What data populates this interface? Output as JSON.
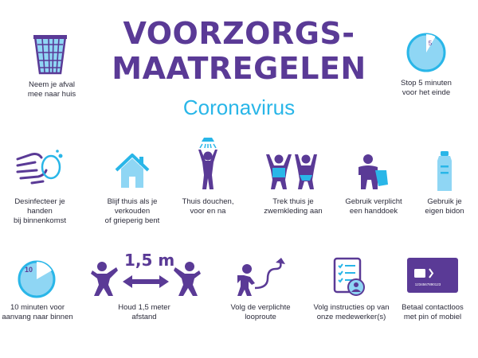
{
  "header": {
    "title_line1": "VOORZORGS-",
    "title_line2": "MAATREGELEN",
    "subtitle": "Coronavirus"
  },
  "colors": {
    "purple": "#5a3a96",
    "blue": "#29b6e8",
    "lightblue": "#8fd6f4"
  },
  "items": [
    {
      "icon": "trash-basket-icon",
      "line1": "Neem je afval",
      "line2": "mee naar huis"
    },
    {
      "icon": "clock-5-icon",
      "clock_label": "5",
      "line1": "Stop 5 minuten",
      "line2": "voor het einde"
    },
    {
      "icon": "washing-hands-icon",
      "line1": "Desinfecteer je handen",
      "line2": "bij binnenkomst"
    },
    {
      "icon": "house-icon",
      "line1": "Blijf thuis als je verkouden",
      "line2": "of grieperig bent"
    },
    {
      "icon": "shower-icon",
      "line1": "Thuis douchen,",
      "line2": "voor en na"
    },
    {
      "icon": "swimwear-icon",
      "line1": "Trek thuis je",
      "line2": "zwemkleding aan"
    },
    {
      "icon": "towel-icon",
      "line1": "Gebruik verplicht",
      "line2": "een handdoek"
    },
    {
      "icon": "water-bottle-icon",
      "line1": "Gebruik je",
      "line2": "eigen bidon"
    },
    {
      "icon": "clock-10-icon",
      "clock_label": "10",
      "line1": "10 minuten voor",
      "line2": "aanvang naar binnen"
    },
    {
      "icon": "distance-icon",
      "distance_label": "1,5 m",
      "line1": "Houd 1,5 meter",
      "line2": "afstand"
    },
    {
      "icon": "walking-route-icon",
      "line1": "Volg de verplichte",
      "line2": "looproute"
    },
    {
      "icon": "instructions-clipboard-icon",
      "line1": "Volg instructies op van",
      "line2": "onze medewerker(s)"
    },
    {
      "icon": "contactless-card-icon",
      "card_number": "1234567890123",
      "line1": "Betaal contactloos",
      "line2": "met pin of mobiel"
    }
  ]
}
